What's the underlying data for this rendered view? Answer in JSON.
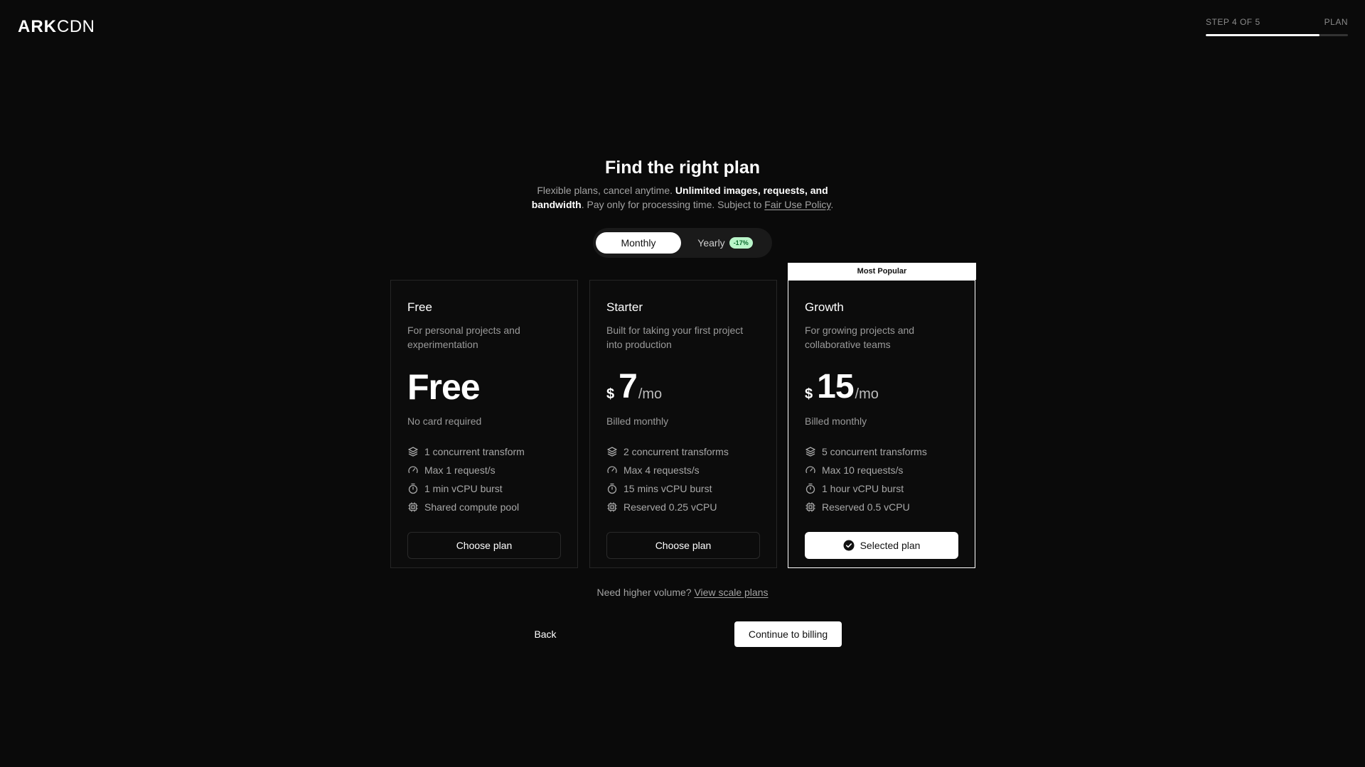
{
  "brand": {
    "part1": "ARK",
    "part2": "CDN"
  },
  "progress": {
    "step_label": "STEP 4 OF 5",
    "section_label": "PLAN",
    "fraction": 0.8
  },
  "hero": {
    "title": "Find the right plan",
    "sub_1": "Flexible plans, cancel anytime. ",
    "sub_bold": "Unlimited images, requests, and bandwidth",
    "sub_2": ". Pay only for processing time. Subject to ",
    "sub_link": "Fair Use Policy",
    "sub_3": "."
  },
  "toggle": {
    "monthly": "Monthly",
    "yearly": "Yearly",
    "discount": "-17%",
    "selected": "monthly"
  },
  "popular_tag": "Most Popular",
  "plans": [
    {
      "name": "Free",
      "desc": "For personal projects and experimentation",
      "price_display": "Free",
      "note": "No card required",
      "features": [
        "1 concurrent transform",
        "Max 1 request/s",
        "1 min vCPU burst",
        "Shared compute pool"
      ],
      "button": "Choose plan"
    },
    {
      "name": "Starter",
      "desc": "Built for taking your first project into production",
      "currency": "$",
      "amount": "7",
      "period": "/mo",
      "note": "Billed monthly",
      "features": [
        "2 concurrent transforms",
        "Max 4 requests/s",
        "15 mins vCPU burst",
        "Reserved 0.25 vCPU"
      ],
      "button": "Choose plan"
    },
    {
      "name": "Growth",
      "desc": "For growing projects and collaborative teams",
      "currency": "$",
      "amount": "15",
      "period": "/mo",
      "note": "Billed monthly",
      "features": [
        "5 concurrent transforms",
        "Max 10 requests/s",
        "1 hour vCPU burst",
        "Reserved 0.5 vCPU"
      ],
      "button": "Selected plan"
    }
  ],
  "scale": {
    "text": "Need higher volume? ",
    "link": "View scale plans"
  },
  "nav": {
    "back": "Back",
    "continue": "Continue to billing"
  },
  "icons": [
    "layers-icon",
    "gauge-icon",
    "stopwatch-icon",
    "cpu-icon"
  ],
  "colors": {
    "background": "#0a0a0a",
    "accent": "#ffffff",
    "discount_bg": "#b9f5c9",
    "discount_fg": "#0b6b2e"
  }
}
